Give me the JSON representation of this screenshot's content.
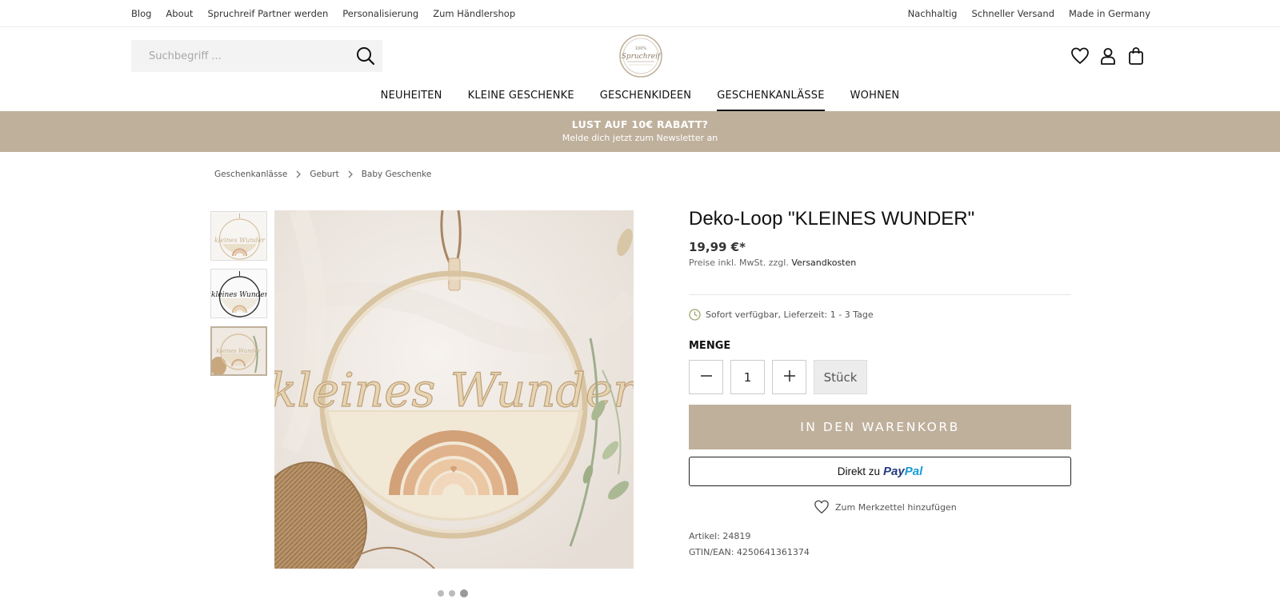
{
  "topbar": {
    "left_links": [
      "Blog",
      "About",
      "Spruchreif Partner werden",
      "Personalisierung",
      "Zum Händlershop"
    ],
    "right_links": [
      "Nachhaltig",
      "Schneller Versand",
      "Made in Germany"
    ]
  },
  "header": {
    "search_placeholder": "Suchbegriff ...",
    "logo_text_top": "100%",
    "logo_text_main": "Spruchreif",
    "icons": [
      "heart-icon",
      "user-icon",
      "shopping-bag-icon"
    ]
  },
  "nav": {
    "items": [
      "NEUHEITEN",
      "KLEINE GESCHENKE",
      "GESCHENKIDEEN",
      "GESCHENKANLÄSSE",
      "WOHNEN"
    ],
    "active": "GESCHENKANLÄSSE"
  },
  "banner": {
    "title": "LUST AUF 10€ RABATT?",
    "subtitle": "Melde dich jetzt zum Newsletter an"
  },
  "breadcrumb": [
    "Geschenkanlässe",
    "Geburt",
    "Baby Geschenke"
  ],
  "gallery": {
    "thumb_count": 3,
    "active_thumb": 3,
    "image_text": "kleines Wunder",
    "dot_count": 3,
    "active_dot": 3
  },
  "product": {
    "title": "Deko-Loop \"KLEINES WUNDER\"",
    "price": "19,99 €*",
    "tax_note": "Preise inkl. MwSt. zzgl.",
    "shipping_link": "Versandkosten",
    "availability": "Sofort verfügbar, Lieferzeit: 1 - 3 Tage",
    "quantity_label": "MENGE",
    "quantity": "1",
    "unit": "Stück",
    "cart_button": "IN DEN WARENKORB",
    "paypal_prefix": "Direkt zu",
    "paypal_brand_1": "Pay",
    "paypal_brand_2": "Pal",
    "wishlist": "Zum Merkzettel hinzufügen",
    "article": "Artikel: 24819",
    "gtin": "GTIN/EAN: 4250641361374"
  },
  "colors": {
    "accent": "#bfb09c",
    "paypal_dark": "#253b80",
    "paypal_light": "#179bd7"
  }
}
